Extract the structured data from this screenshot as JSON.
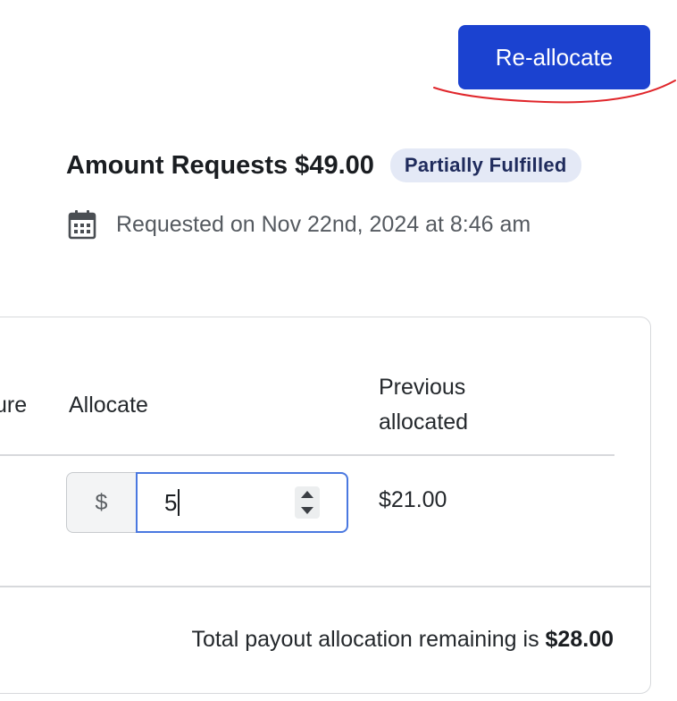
{
  "header": {
    "action_button_label": "Re-allocate",
    "title": "Amount Requests $49.00",
    "status_badge": "Partially Fulfilled",
    "requested_on": "Requested on Nov 22nd, 2024 at 8:46 am"
  },
  "table": {
    "columns": [
      "ure",
      "Allocate",
      "Previous allocated"
    ],
    "rows": [
      {
        "allocate_prefix": "$",
        "allocate_value": "5",
        "previous_allocated": "$21.00"
      }
    ]
  },
  "footer": {
    "remaining_label": "Total payout allocation remaining is",
    "remaining_amount": "$28.00"
  },
  "colors": {
    "primary": "#1b42d0",
    "annotation_mark": "#e0262b",
    "badge_bg": "#e4e9f6",
    "input_focus_border": "#4a78e0"
  },
  "icons": {
    "date": "calendar-icon",
    "stepper_up": "chevron-up-icon",
    "stepper_down": "chevron-down-icon"
  }
}
